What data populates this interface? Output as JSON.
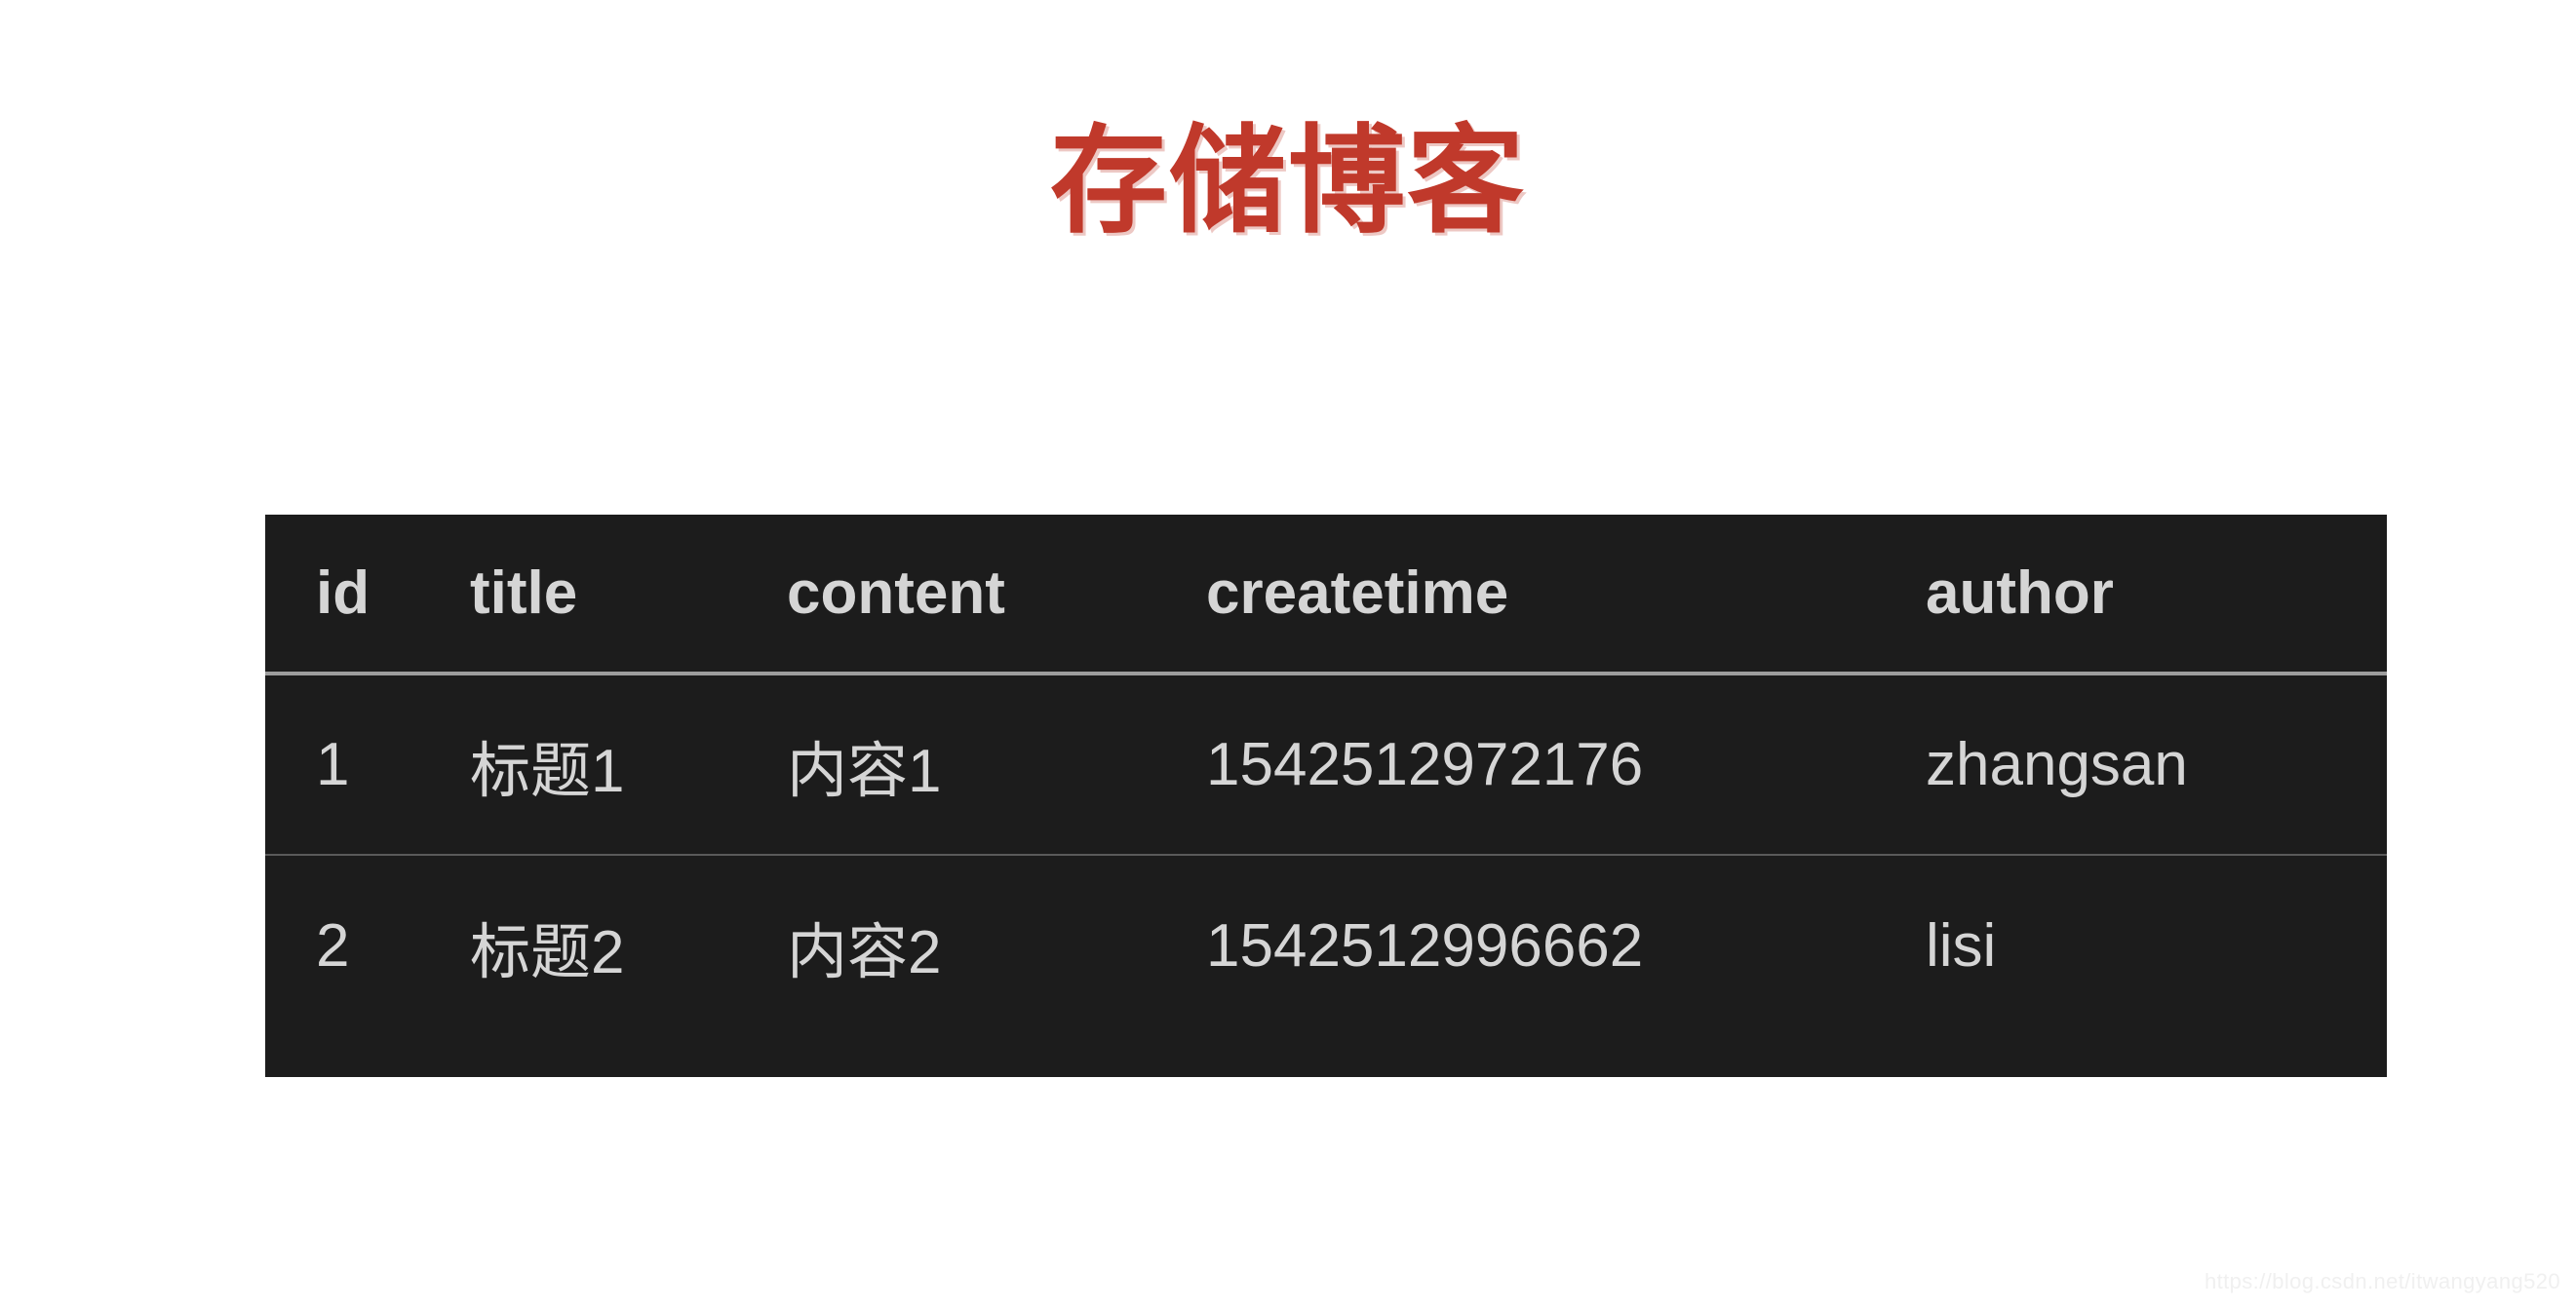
{
  "page": {
    "title": "存储博客",
    "title_color": "#c0392b",
    "background_color": "#ffffff"
  },
  "table": {
    "background_color": "#1c1c1c",
    "text_color": "#d5d5d5",
    "header_rule_color": "#9d9d9d",
    "row_rule_color": "#5a5a5a",
    "columns": [
      {
        "key": "id",
        "label": "id"
      },
      {
        "key": "title",
        "label": "title"
      },
      {
        "key": "content",
        "label": "content"
      },
      {
        "key": "createtime",
        "label": "createtime"
      },
      {
        "key": "author",
        "label": "author"
      }
    ],
    "rows": [
      {
        "id": "1",
        "title": "标题1",
        "content": "内容1",
        "createtime": "1542512972176",
        "author": "zhangsan"
      },
      {
        "id": "2",
        "title": "标题2",
        "content": "内容2",
        "createtime": "1542512996662",
        "author": "lisi"
      }
    ]
  },
  "watermark": {
    "text": "https://blog.csdn.net/itwangyang520"
  }
}
